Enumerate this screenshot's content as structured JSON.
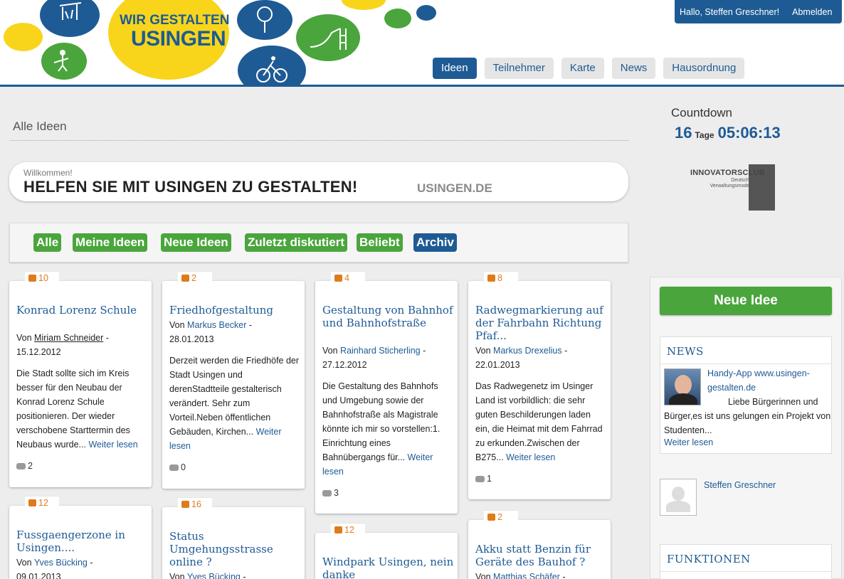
{
  "header": {
    "logo_line1": "WIR GESTALTEN",
    "logo_line2": "USINGEN",
    "greeting": "Hallo, Steffen Greschner!",
    "logout": "Abmelden",
    "nav": [
      {
        "label": "Ideen",
        "active": true
      },
      {
        "label": "Teilnehmer"
      },
      {
        "label": "Karte"
      },
      {
        "label": "News"
      },
      {
        "label": "Hausordnung"
      }
    ]
  },
  "main": {
    "section_title": "Alle Ideen",
    "welcome_small": "Willkommen!",
    "welcome_big": "HELFEN SIE MIT USINGEN ZU GESTALTEN!",
    "welcome_domain": "USINGEN.DE",
    "filters": [
      "Alle",
      "Meine Ideen",
      "Neue Ideen",
      "Zuletzt diskutiert",
      "Beliebt",
      "Archiv"
    ],
    "cards": [
      {
        "votes": "10",
        "title": "Konrad Lorenz Schule",
        "by": "Von",
        "author": "Miriam Schneider",
        "date": "15.12.2012",
        "text": "Die Stadt sollte sich im Kreis besser für den Neubau der Konrad Lorenz Schule positionieren. Der wieder verschobene Starttermin des Neubaus wurde...",
        "more": "Weiter lesen",
        "comments": "2"
      },
      {
        "votes": "2",
        "title": "Friedhofgestaltung",
        "by": "Von",
        "author": "Markus Becker",
        "date": "28.01.2013",
        "text": "Derzeit werden die Friedhöfe der Stadt Usingen und derenStadtteile gestalterisch verändert. Sehr zum Vorteil.Neben öffentlichen Gebäuden, Kirchen...",
        "more": "Weiter lesen",
        "comments": "0"
      },
      {
        "votes": "4",
        "title": "Gestaltung von Bahnhof und Bahnhofstraße",
        "by": "Von",
        "author": "Rainhard Sticherling",
        "date": "27.12.2012",
        "text": "Die Gestaltung des Bahnhofs und Umgebung sowie der Bahnhofstraße als Magistrale könnte ich mir so vorstellen:1. Einrichtung eines Bahnübergangs für...",
        "more": "Weiter lesen",
        "comments": "3"
      },
      {
        "votes": "8",
        "title": "Radwegmarkierung auf der Fahrbahn Richtung Pfaf...",
        "by": "Von",
        "author": "Markus Drexelius",
        "date": "22.01.2013",
        "text": "Das Radwegenetz im Usinger Land ist vorbildlich: die sehr guten Beschilderungen laden ein, die Heimat mit dem Fahrrad zu erkunden.Zwischen der B275...",
        "more": "Weiter lesen",
        "comments": "1"
      },
      {
        "votes": "12",
        "title": "Fussgaengerzone in Usingen....",
        "by": "Von",
        "author": "Yves Bücking",
        "date": "09.01.2013"
      },
      {
        "votes": "16",
        "title": "Status Umgehungsstrasse online ?",
        "by": "Von",
        "author": "Yves Bücking",
        "date": ""
      },
      {
        "votes": "12",
        "title": "Windpark Usingen, nein danke",
        "by": "",
        "author": "",
        "date": ""
      },
      {
        "votes": "2",
        "title": "Akku statt Benzin für Geräte des Bauhof ?",
        "by": "Von",
        "author": "Matthias Schäfer",
        "date": ""
      }
    ]
  },
  "sidebar": {
    "countdown_label": "Countdown",
    "countdown_days": "16",
    "countdown_unit": "Tage",
    "countdown_time": "05:06:13",
    "partner_name": "INNOVATORSCLUB",
    "partner_sub1": "Deutschlandforum",
    "partner_sub2": "Verwaltungsmodernisierung",
    "new_idea": "Neue Idee",
    "news_title": "NEWS",
    "news_link": "Handy-App www.usingen-gestalten.de",
    "news_text": "Liebe Bürgerinnen und Bürger,es ist uns gelungen ein Projekt von Studenten...",
    "news_more": "Weiter lesen",
    "user_name": "Steffen Greschner",
    "functions_title": "FUNKTIONEN"
  },
  "colors": {
    "brand_blue": "#1e5b94",
    "green": "#4aa53c",
    "orange": "#e07b1a"
  }
}
